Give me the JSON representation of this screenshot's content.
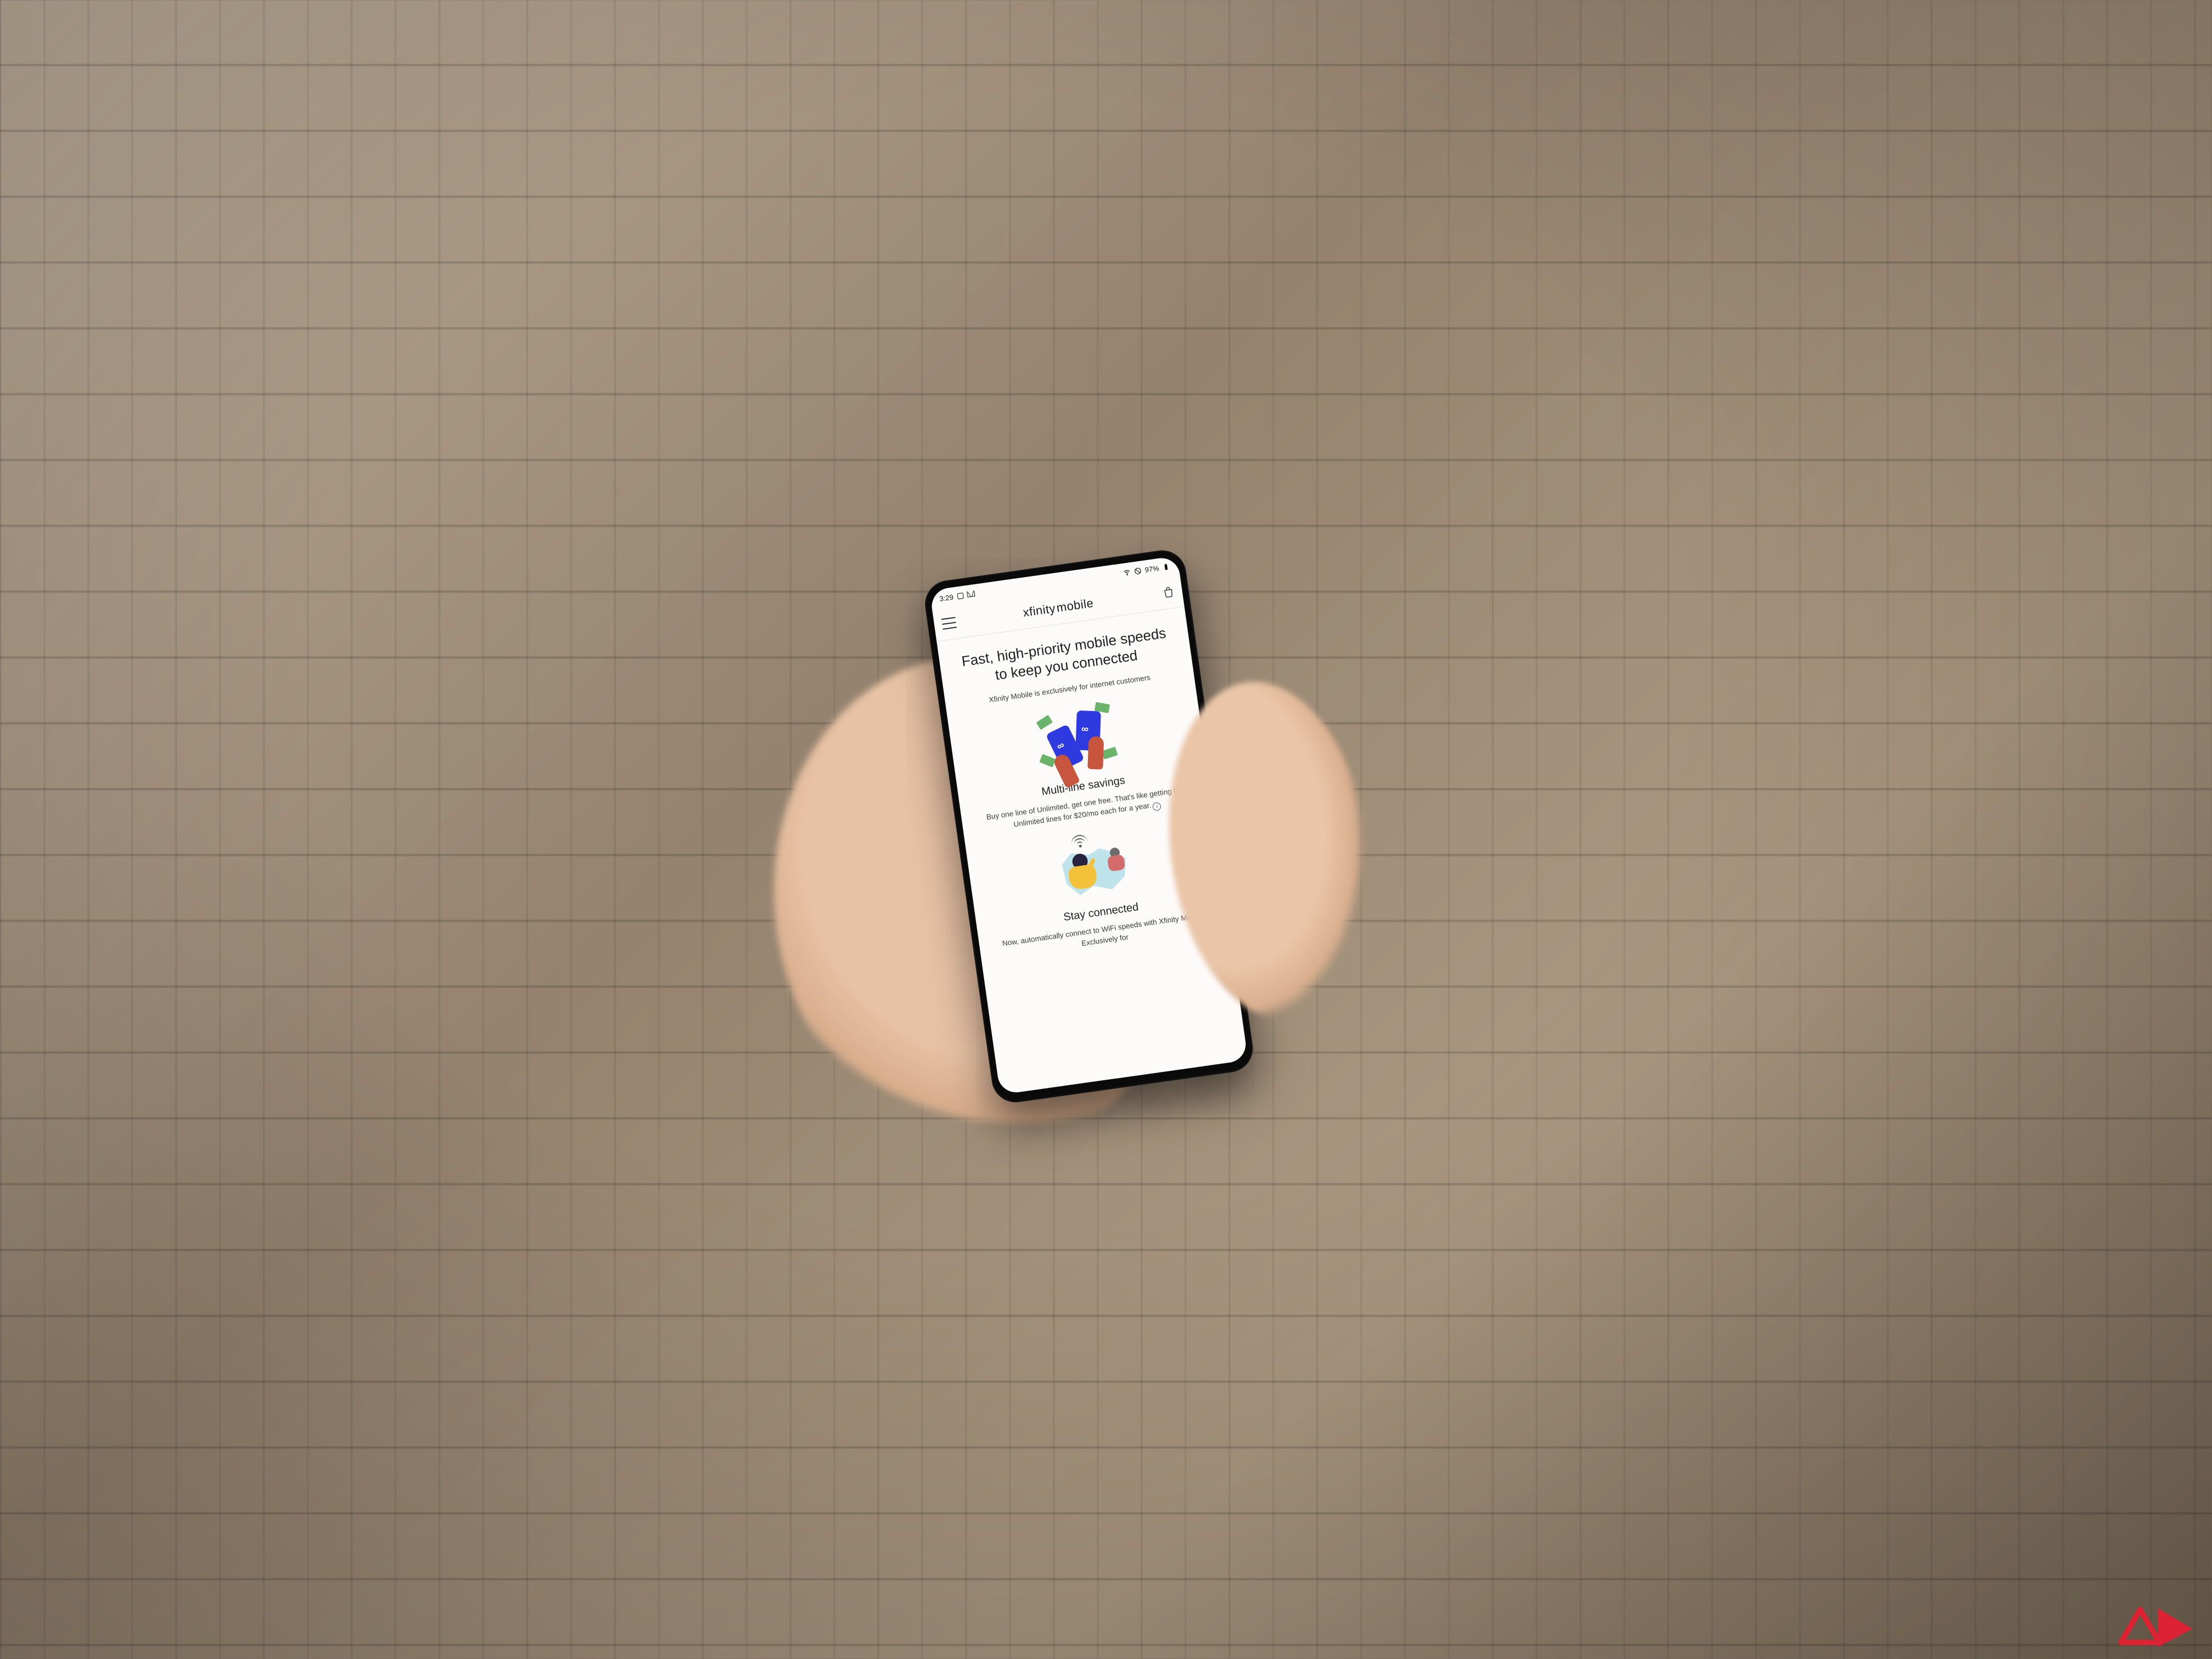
{
  "statusbar": {
    "time": "3:29",
    "battery_text": "97%"
  },
  "header": {
    "brand_primary": "xfinity",
    "brand_secondary": "mobile"
  },
  "hero": {
    "title": "Fast, high-priority mobile speeds to keep you connected",
    "subtitle": "Xfinity Mobile is exclusively for internet customers"
  },
  "features": [
    {
      "title": "Multi-line savings",
      "body": "Buy one line of Unlimited, get one free. That's like getting two Unlimited lines for $20/mo each for a year.",
      "has_info": true
    },
    {
      "title": "Stay connected",
      "body": "Now, automatically connect to WiFi speeds with Xfinity Mobile. Exclusively for",
      "has_info": false
    }
  ]
}
